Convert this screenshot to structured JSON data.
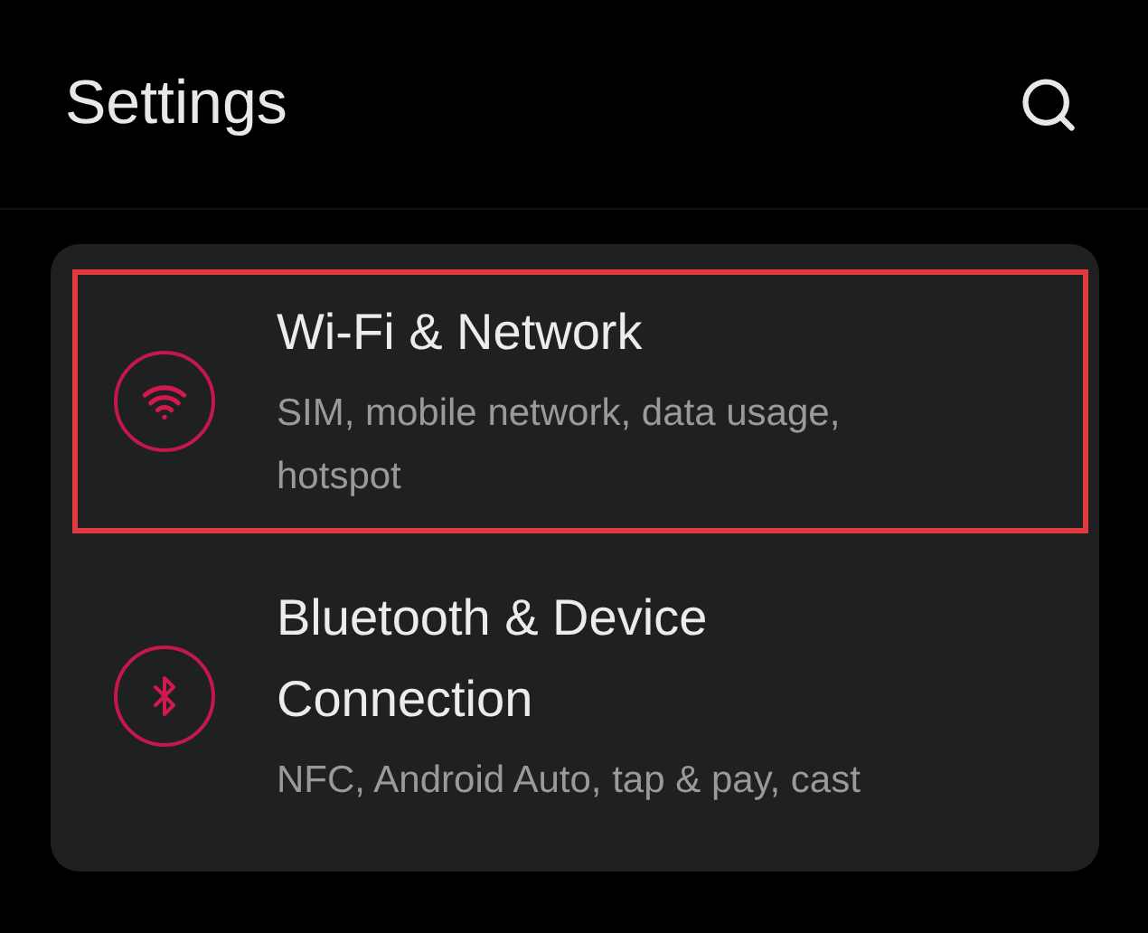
{
  "header": {
    "title": "Settings"
  },
  "items": [
    {
      "kind": "wifi",
      "title": "Wi-Fi & Network",
      "subtitle": "SIM, mobile network, data usage, hotspot",
      "highlighted": true
    },
    {
      "kind": "bluetooth",
      "title": "Bluetooth & Device Connection",
      "subtitle": "NFC, Android Auto, tap & pay, cast",
      "highlighted": false
    }
  ]
}
